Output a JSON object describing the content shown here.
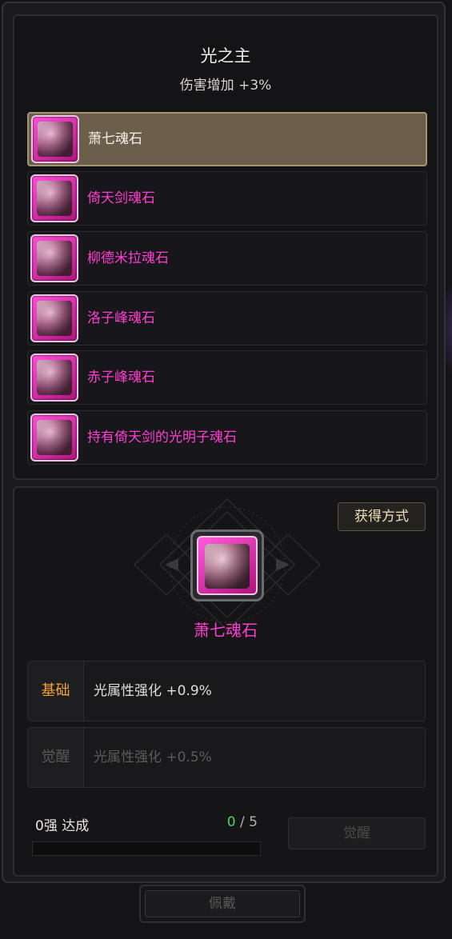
{
  "header": {
    "title": "光之主",
    "subtitle": "伤害增加  +3%"
  },
  "stones": [
    {
      "name": "萧七魂石",
      "selected": true
    },
    {
      "name": "倚天剑魂石",
      "selected": false
    },
    {
      "name": "柳德米拉魂石",
      "selected": false
    },
    {
      "name": "洛子峰魂石",
      "selected": false
    },
    {
      "name": "赤子峰魂石",
      "selected": false
    },
    {
      "name": "持有倚天剑的光明子魂石",
      "selected": false
    }
  ],
  "detail": {
    "acquire_label": "获得方式",
    "selected_name": "萧七魂石",
    "base": {
      "label": "基础",
      "value": "光属性强化 +0.9%"
    },
    "awaken": {
      "label": "觉醒",
      "value": "光属性强化 +0.5%"
    },
    "progress": {
      "label": "0强 达成",
      "current": "0",
      "separator": " / ",
      "total": "5",
      "fraction": 0
    },
    "awaken_button": "觉醒"
  },
  "equip_button": "佩戴",
  "colors": {
    "rarity_pink": "#ff3fd0",
    "base_label": "#f0a43a",
    "progress_green": "#4fd26a",
    "selected_row": "#6b5e4b"
  }
}
